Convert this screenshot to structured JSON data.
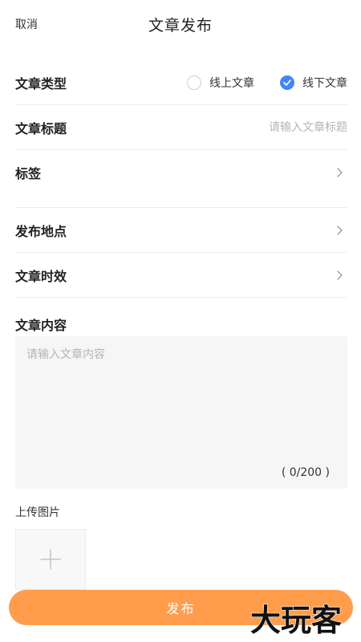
{
  "header": {
    "cancel_label": "取消",
    "title": "文章发布"
  },
  "form": {
    "type": {
      "label": "文章类型",
      "options": [
        {
          "label": "线上文章",
          "selected": false
        },
        {
          "label": "线下文章",
          "selected": true
        }
      ]
    },
    "title_field": {
      "label": "文章标题",
      "placeholder": "请输入文章标题",
      "value": ""
    },
    "tags": {
      "label": "标签"
    },
    "location": {
      "label": "发布地点"
    },
    "timeliness": {
      "label": "文章时效"
    },
    "content": {
      "label": "文章内容",
      "placeholder": "请输入文章内容",
      "counter": "( 0/200 )"
    },
    "upload": {
      "label": "上传图片"
    }
  },
  "footer": {
    "publish_label": "发布"
  },
  "watermark": {
    "text": "大玩客"
  },
  "colors": {
    "accent": "#3f87f5",
    "publish": "#ff9d4d",
    "divider": "#ececec",
    "placeholder": "#b5b5b5"
  },
  "icons": {
    "row_arrow": "chevron-right-icon",
    "radio_checked": "check-icon",
    "upload": "plus-icon"
  }
}
